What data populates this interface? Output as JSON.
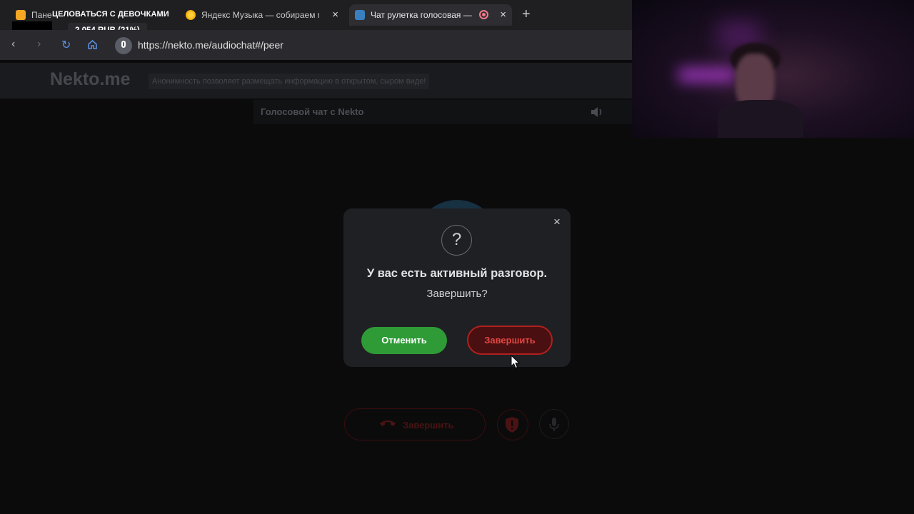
{
  "browser": {
    "tabs": [
      {
        "title": "Пане"
      },
      {
        "title": "Яндекс Музыка — собираем м"
      },
      {
        "title": "Чат рулетка голосовая —"
      }
    ],
    "overlay_title": "ЦЕЛОВАТЬСЯ С ДЕВОЧКАМИ",
    "price_badge": "2 054 RUB (21%)",
    "url": "https://nekto.me/audiochat#/peer",
    "new_tab": "+"
  },
  "site": {
    "logo": "Nekto.me",
    "tagline": "Анонимность позволяет размещать информацию в открытом, сыром виде!",
    "chat_title": "Голосовой чат с Nekto"
  },
  "modal": {
    "question_mark": "?",
    "title": "У вас есть активный разговор.",
    "subtitle": "Завершить?",
    "cancel_label": "Отменить",
    "end_label": "Завершить",
    "close": "×"
  },
  "controls": {
    "end_call_label": "Завершить"
  },
  "colors": {
    "cancel_green": "#2e9b36",
    "end_red": "#b0201f"
  }
}
